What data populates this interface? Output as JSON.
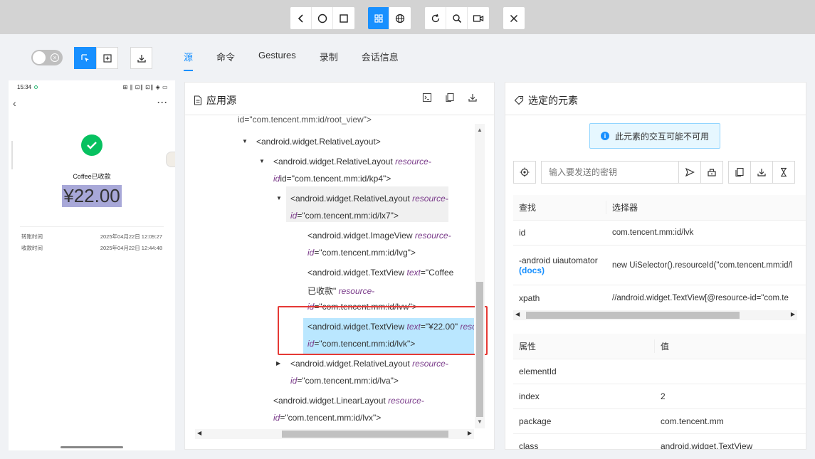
{
  "toolbar": {
    "group1": [
      "back-icon",
      "home-icon",
      "app-switch-icon"
    ],
    "group2": [
      "native-mode-icon",
      "web-mode-icon"
    ],
    "group3": [
      "refresh-icon",
      "search-icon",
      "record-icon"
    ],
    "group4": [
      "close-icon"
    ]
  },
  "tabs": [
    {
      "label": "源",
      "active": true
    },
    {
      "label": "命令",
      "active": false
    },
    {
      "label": "Gestures",
      "active": false
    },
    {
      "label": "录制",
      "active": false
    },
    {
      "label": "会话信息",
      "active": false
    }
  ],
  "phone": {
    "time": "15:34",
    "status_icons": "⊞ ∥ ⊡∥ ⊡∥ ◈ ▭",
    "merchant": "Coffee已收款",
    "amount": "¥22.00",
    "rows": [
      {
        "label": "转账时间",
        "value": "2025年04月22日 12:09:27"
      },
      {
        "label": "收款时间",
        "value": "2025年04月22日 12:44:48"
      }
    ]
  },
  "source": {
    "title": "应用源",
    "lines": [
      {
        "text": "id=\"com.tencent.mm:id/root_view\">",
        "parts": null
      },
      {
        "tag": "<android.widget.RelativeLayout>"
      },
      {
        "tag": "<android.widget.RelativeLayout",
        "attr": "resource-",
        "line2": "id=\"com.tencent.mm:id/kp4\">",
        "attr2": "id"
      },
      {
        "tag": "<android.widget.RelativeLayout",
        "attr": "resource-",
        "line2": "=\"com.tencent.mm:id/lx7\">"
      },
      {
        "tag": "<android.widget.ImageView",
        "attr": "resource-",
        "line2": "=\"com.tencent.mm:id/lvg\">"
      },
      {
        "tag": "<android.widget.TextView",
        "attr": "text",
        "val": "=\"Coffee",
        "line2": "已收款\"",
        "attr2": "resource-",
        "line3": "=\"com.tencent.mm:id/lvw\">"
      },
      {
        "tag": "<android.widget.TextView",
        "attr": "text",
        "val": "=\"¥22.00\"",
        "attr_tail": "reso",
        "line2": "=\"com.tencent.mm:id/lvk\">"
      },
      {
        "tag": "<android.widget.RelativeLayout",
        "attr": "resource-",
        "line2": "=\"com.tencent.mm:id/lva\">"
      },
      {
        "tag": "<android.widget.LinearLayout",
        "attr": "resource-",
        "line2": "=\"com.tencent.mm:id/lvx\">"
      }
    ],
    "id_prefix": "id"
  },
  "selected": {
    "title": "选定的元素",
    "info": "此元素的交互可能不可用",
    "key_placeholder": "输入要发送的密钥",
    "find_table": {
      "headers": [
        "查找",
        "选择器"
      ],
      "rows": [
        {
          "k": "id",
          "v": "com.tencent.mm:id/lvk"
        },
        {
          "k": "-android uiautomator",
          "docs": "(docs)",
          "v": "new UiSelector().resourceId(\"com.tencent.mm:id/l"
        },
        {
          "k": "xpath",
          "v": "//android.widget.TextView[@resource-id=\"com.te"
        }
      ]
    },
    "attr_table": {
      "headers": [
        "属性",
        "值"
      ],
      "rows": [
        {
          "k": "elementId",
          "v": ""
        },
        {
          "k": "index",
          "v": "2"
        },
        {
          "k": "package",
          "v": "com.tencent.mm"
        },
        {
          "k": "class",
          "v": "android.widget.TextView"
        }
      ]
    }
  }
}
